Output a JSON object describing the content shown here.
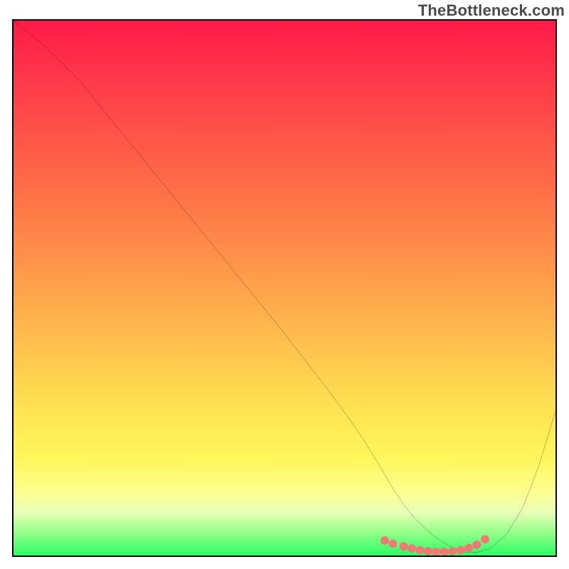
{
  "watermark": "TheBottleneck.com",
  "chart_data": {
    "type": "line",
    "title": "",
    "xlabel": "",
    "ylabel": "",
    "xlim": [
      0,
      100
    ],
    "ylim": [
      0,
      100
    ],
    "series": [
      {
        "name": "curve",
        "x": [
          0,
          6,
          12,
          20,
          30,
          40,
          50,
          58,
          62,
          65,
          68,
          70,
          72,
          74,
          76,
          78,
          80,
          82,
          83.5,
          85.5,
          88,
          91,
          94,
          97,
          100
        ],
        "y": [
          100,
          95,
          89,
          79,
          66.5,
          54,
          41.5,
          31,
          25.5,
          21,
          16,
          12.5,
          9.5,
          7,
          5,
          3.3,
          2,
          1.1,
          0.6,
          0.6,
          1.3,
          4,
          9,
          17,
          27
        ]
      },
      {
        "name": "dots",
        "x": [
          68.5,
          70,
          72,
          73.5,
          75,
          76.5,
          78,
          79.5,
          81,
          82.5,
          84,
          85.5,
          87
        ],
        "y": [
          2.8,
          2.2,
          1.7,
          1.3,
          1.0,
          0.8,
          0.7,
          0.7,
          0.8,
          1.0,
          1.4,
          2.0,
          3.0
        ]
      }
    ],
    "gradient_stops": [
      {
        "pos": 0,
        "color": "#ff1a47"
      },
      {
        "pos": 12,
        "color": "#ff3b4a"
      },
      {
        "pos": 30,
        "color": "#ff6a47"
      },
      {
        "pos": 45,
        "color": "#ff934a"
      },
      {
        "pos": 60,
        "color": "#ffbf4d"
      },
      {
        "pos": 73,
        "color": "#ffe452"
      },
      {
        "pos": 82,
        "color": "#fff75e"
      },
      {
        "pos": 88,
        "color": "#fdff8e"
      },
      {
        "pos": 92,
        "color": "#e8ffb8"
      },
      {
        "pos": 96,
        "color": "#8eff86"
      },
      {
        "pos": 100,
        "color": "#2bff65"
      }
    ],
    "curve_stroke": "#000000",
    "dot_fill": "#ed7b74",
    "dot_radius": 6
  }
}
